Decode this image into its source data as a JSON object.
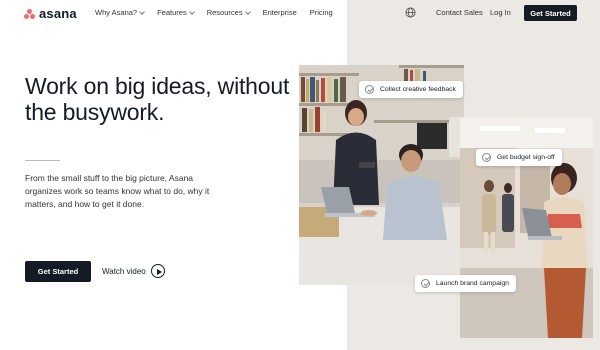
{
  "nav": {
    "brand": "asana",
    "links": [
      {
        "label": "Why Asana?",
        "dropdown": true
      },
      {
        "label": "Features",
        "dropdown": true
      },
      {
        "label": "Resources",
        "dropdown": true
      },
      {
        "label": "Enterprise",
        "dropdown": false
      },
      {
        "label": "Pricing",
        "dropdown": false
      }
    ],
    "globe_icon": "globe-icon",
    "contact_sales": "Contact Sales",
    "log_in": "Log In",
    "cta": "Get Started"
  },
  "hero": {
    "headline": "Work on big ideas, without the busywork.",
    "subtext": "From the small stuff to the big picture, Asana organizes work so teams know what to do, why it matters, and how to get it done.",
    "primary_button": "Get Started",
    "watch_video": "Watch video"
  },
  "task_chips": [
    {
      "label": "Collect creative feedback"
    },
    {
      "label": "Get budget sign-off"
    },
    {
      "label": "Launch brand campaign"
    }
  ],
  "colors": {
    "brand_coral": "#f06a6a",
    "dark": "#151b26",
    "panel": "#ece8e4"
  }
}
